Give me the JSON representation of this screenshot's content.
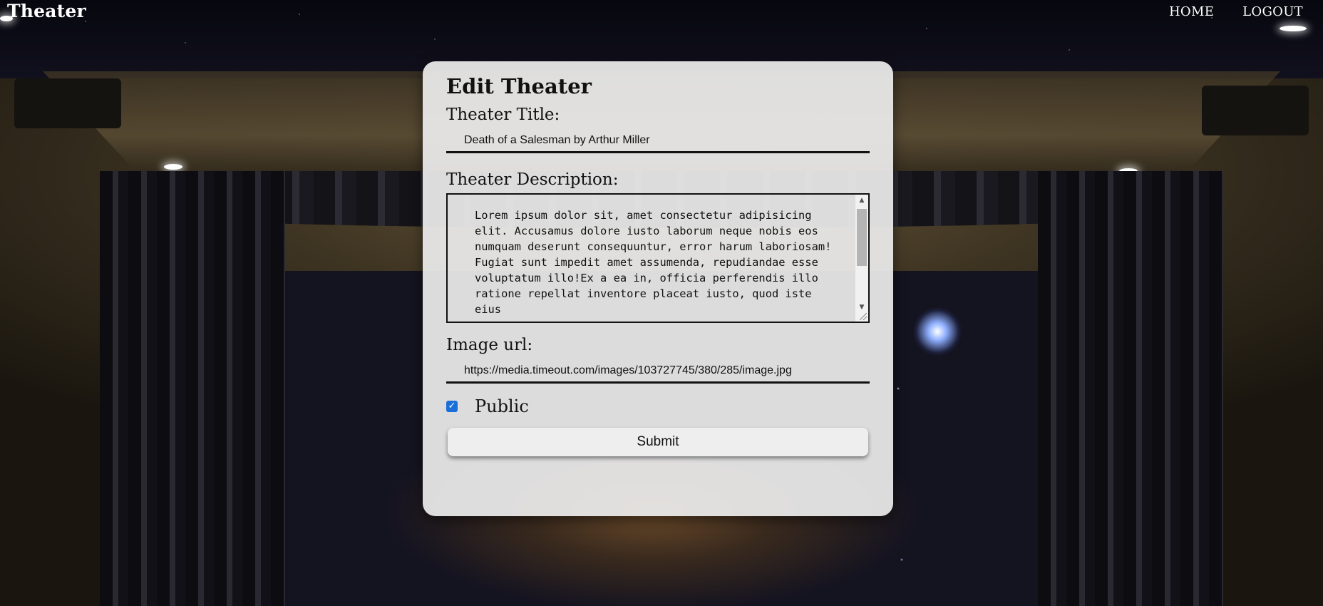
{
  "brand": {
    "title": "Theater"
  },
  "nav": {
    "home": "HOME",
    "logout": "LOGOUT"
  },
  "form": {
    "heading": "Edit Theater",
    "title_label": "Theater Title:",
    "title_value": "Death of a Salesman by Arthur Miller",
    "description_label": "Theater Description:",
    "description_value": "Lorem ipsum dolor sit, amet consectetur adipisicing elit. Accusamus dolore iusto laborum neque nobis eos numquam deserunt consequuntur, error harum laboriosam! Fugiat sunt impedit amet assumenda, repudiandae esse voluptatum illo!Ex a ea in, officia perferendis illo ratione repellat inventore placeat iusto, quod iste eius",
    "image_label": "Image url:",
    "image_value": "https://media.timeout.com/images/103727745/380/285/image.jpg",
    "public_label": "Public",
    "public_checked": true,
    "submit_label": "Submit"
  },
  "colors": {
    "checkbox": "#1a6ed8",
    "card": "#ececec"
  }
}
